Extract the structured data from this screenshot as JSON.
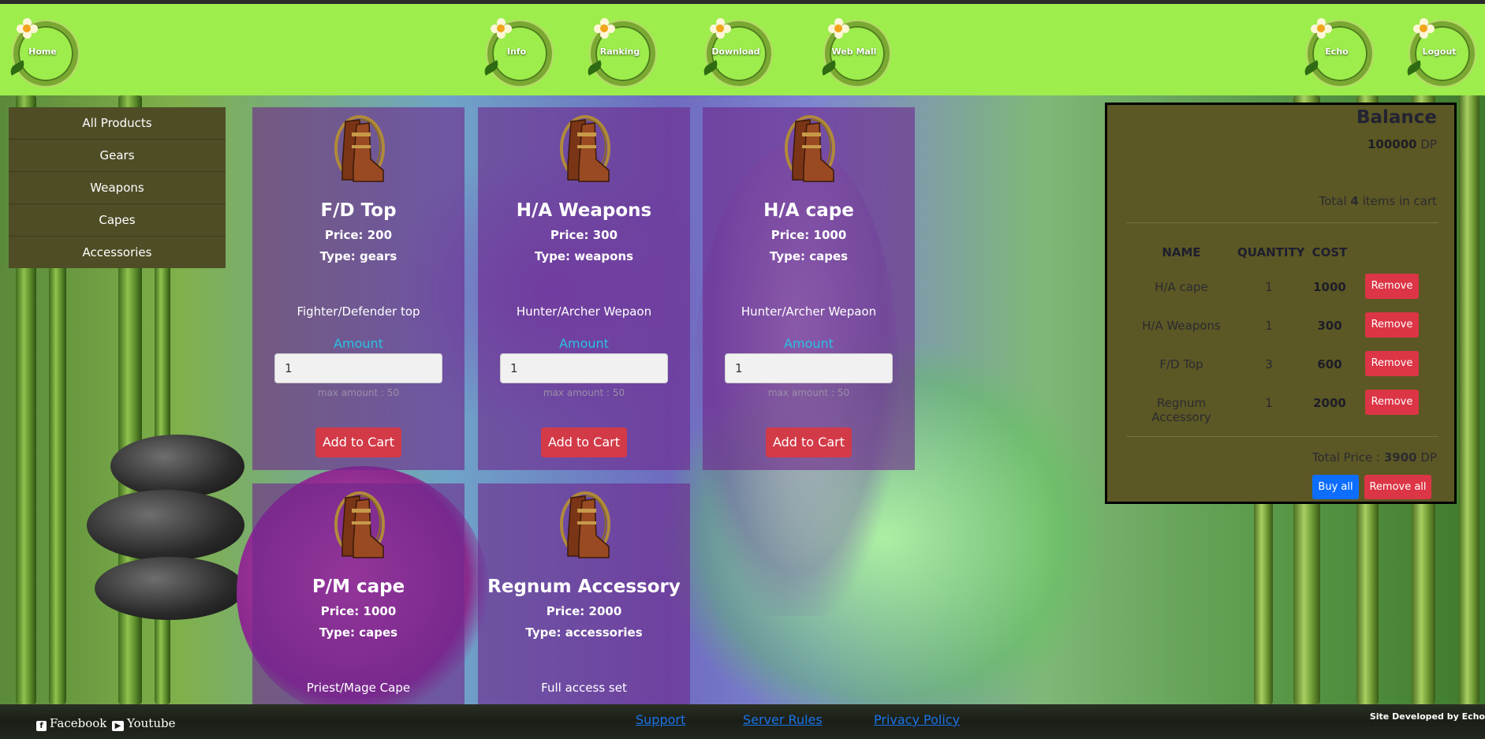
{
  "nav": {
    "home": "Home",
    "info": "Info",
    "ranking": "Ranking",
    "download": "Download",
    "webmall": "Web Mall",
    "user": "Echo",
    "logout": "Logout"
  },
  "categories": [
    "All Products",
    "Gears",
    "Weapons",
    "Capes",
    "Accessories"
  ],
  "products": [
    {
      "name": "F/D Top",
      "price": "Price: 200",
      "type": "Type: gears",
      "desc": "Fighter/Defender top",
      "amount_label": "Amount",
      "amount": "1",
      "max": "max amount : 50",
      "add": "Add to Cart"
    },
    {
      "name": "H/A Weapons",
      "price": "Price: 300",
      "type": "Type: weapons",
      "desc": "Hunter/Archer Wepaon",
      "amount_label": "Amount",
      "amount": "1",
      "max": "max amount : 50",
      "add": "Add to Cart"
    },
    {
      "name": "H/A cape",
      "price": "Price: 1000",
      "type": "Type: capes",
      "desc": "Hunter/Archer Wepaon",
      "amount_label": "Amount",
      "amount": "1",
      "max": "max amount : 50",
      "add": "Add to Cart"
    },
    {
      "name": "P/M cape",
      "price": "Price: 1000",
      "type": "Type: capes",
      "desc": "Priest/Mage Cape"
    },
    {
      "name": "Regnum Accessory",
      "price": "Price: 2000",
      "type": "Type: accessories",
      "desc": "Full access set"
    }
  ],
  "cart": {
    "balance_title": "Balance",
    "balance_value": "100000",
    "balance_unit": " DP",
    "total_prefix": "Total ",
    "total_count": "4",
    "total_suffix": " items in cart",
    "headers": {
      "name": "NAME",
      "quantity": "QUANTITY",
      "cost": "COST"
    },
    "items": [
      {
        "name": "H/A cape",
        "qty": "1",
        "cost": "1000",
        "remove": "Remove"
      },
      {
        "name": "H/A Weapons",
        "qty": "1",
        "cost": "300",
        "remove": "Remove"
      },
      {
        "name": "F/D Top",
        "qty": "3",
        "cost": "600",
        "remove": "Remove"
      },
      {
        "name": "Regnum Accessory",
        "qty": "1",
        "cost": "2000",
        "remove": "Remove"
      }
    ],
    "total_price_prefix": "Total Price : ",
    "total_price": "3900",
    "total_price_unit": " DP",
    "buy_all": "Buy all",
    "remove_all": "Remove all"
  },
  "footer": {
    "facebook": "Facebook",
    "youtube": "Youtube",
    "support": "Support",
    "rules": "Server Rules",
    "privacy": "Privacy Policy",
    "credit": "Site Developed by Echo"
  },
  "colors": {
    "navbar": "#9ded4d",
    "sidebar": "#4f4d26",
    "card": "#6e288c",
    "cart_bg": "#5c5825",
    "danger": "#dc3545",
    "primary": "#0d6efd",
    "amount_label": "#29c2e3"
  },
  "icons": {
    "nav": "flower-wreath-icon",
    "product": "boots-icon",
    "facebook": "facebook-icon",
    "youtube": "youtube-icon"
  }
}
